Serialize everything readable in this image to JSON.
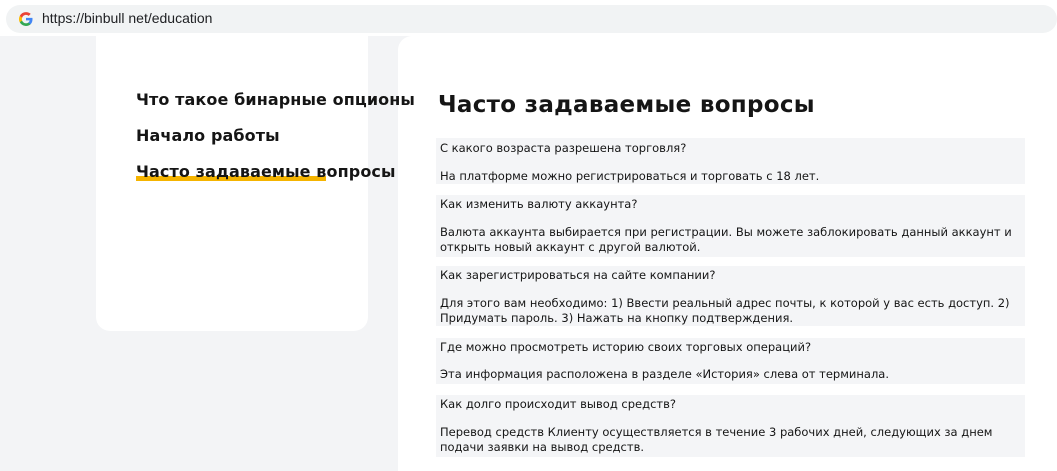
{
  "browser": {
    "url": "https://binbull net/education",
    "favicon": "google-g-icon"
  },
  "sidebar": {
    "items": [
      {
        "label": "Что такое бинарные опционы",
        "active": false
      },
      {
        "label": "Начало работы",
        "active": false
      },
      {
        "label": "Часто задаваемые вопросы",
        "active": true
      }
    ]
  },
  "main": {
    "title": "Часто задаваемые вопросы",
    "faq": [
      {
        "question": "С какого возраста разрешена торговля?",
        "answer": "На платформе можно регистрироваться и торговать с 18 лет."
      },
      {
        "question": "Как изменить валюту аккаунта?",
        "answer": "Валюта аккаунта выбирается при регистрации. Вы можете заблокировать данный аккаунт и открыть новый аккаунт с другой валютой."
      },
      {
        "question": "Как зарегистрироваться на сайте компании?",
        "answer": "Для этого вам необходимо: 1) Ввести реальный адрес почты, к которой у вас есть доступ. 2) Придумать пароль. 3) Нажать на кнопку подтверждения."
      },
      {
        "question": "Где можно просмотреть историю своих торговых операций?",
        "answer": "Эта информация расположена в разделе «История» слева от терминала."
      },
      {
        "question": "Как долго происходит вывод средств?",
        "answer": "Перевод средств Клиенту осуществляется в течение 3 рабочих дней, следующих за днем подачи заявки на вывод средств."
      }
    ]
  },
  "colors": {
    "accent": "#f5b400",
    "faq_bg": "#f4f5f7",
    "page_bg": "#f3f4f6"
  }
}
